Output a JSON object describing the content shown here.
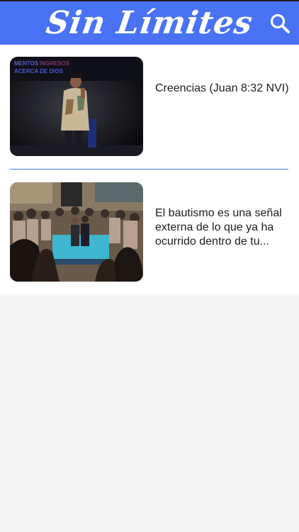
{
  "header": {
    "logo_text": "Sin Límites",
    "search_icon": "search-icon"
  },
  "colors": {
    "header_bg": "#4a72f5",
    "divider": "#4a72f5",
    "list_bg": "#ffffff",
    "page_bg": "#f4f4f4"
  },
  "items": [
    {
      "title": "Creencias (Juan 8:32 NVI)",
      "thumbnail_overlay_text": "MENTOS\nACERCA DE DIOS"
    },
    {
      "title": "El bautismo es una señal externa de lo que ya ha ocurrido dentro de tu..."
    }
  ]
}
